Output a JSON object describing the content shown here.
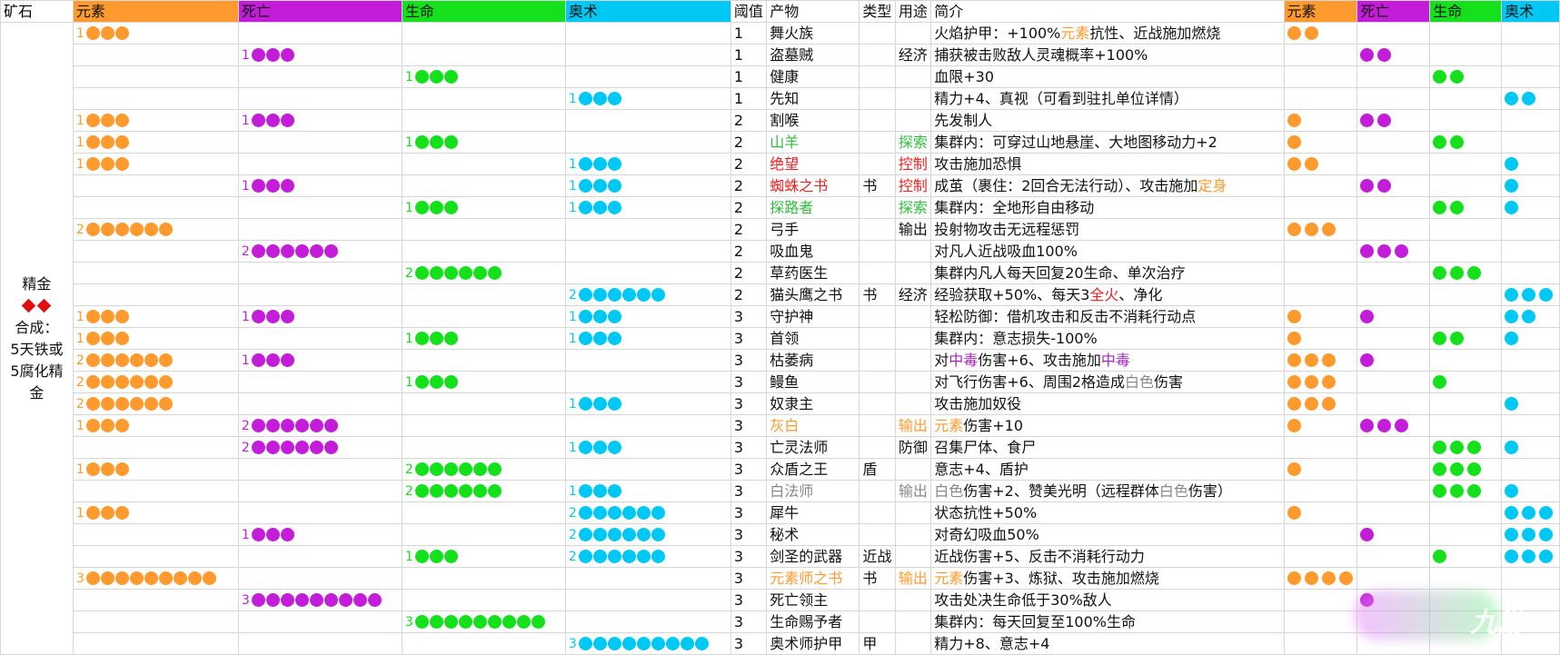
{
  "headers": {
    "ore": "矿石",
    "el": "元素",
    "de": "死亡",
    "li": "生命",
    "ar": "奥术",
    "thr": "阈值",
    "prod": "产物",
    "type": "类型",
    "use": "用途",
    "desc": "简介",
    "el2": "元素",
    "de2": "死亡",
    "li2": "生命",
    "ar2": "奥术"
  },
  "ore": {
    "name": "精金",
    "line1": "合成：",
    "line2": "5天铁或",
    "line3": "5腐化精",
    "line4": "金"
  },
  "colors": {
    "element": "#ff9a2e",
    "death": "#c41dd9",
    "life": "#14e01c",
    "arcane": "#00c8f5"
  },
  "watermark": "九游",
  "rows": [
    {
      "el": 1,
      "de": 0,
      "li": 0,
      "ar": 0,
      "thr": "1",
      "prod": "舞火族",
      "pc": "",
      "type": "",
      "use": "",
      "uc": "",
      "desc": [
        [
          "火焰护甲：+100%",
          ""
        ],
        [
          "元素",
          "t-orange"
        ],
        [
          "抗性、近战施加燃烧",
          ""
        ]
      ],
      "r": [
        2,
        0,
        0,
        0
      ]
    },
    {
      "el": 0,
      "de": 1,
      "li": 0,
      "ar": 0,
      "thr": "1",
      "prod": "盗墓贼",
      "pc": "",
      "type": "",
      "use": "经济",
      "uc": "",
      "desc": [
        [
          "捕获被击败敌人灵魂概率+100%",
          ""
        ]
      ],
      "r": [
        0,
        2,
        0,
        0
      ]
    },
    {
      "el": 0,
      "de": 0,
      "li": 1,
      "ar": 0,
      "thr": "1",
      "prod": "健康",
      "pc": "",
      "type": "",
      "use": "",
      "uc": "",
      "desc": [
        [
          "血限+30",
          ""
        ]
      ],
      "r": [
        0,
        0,
        2,
        0
      ]
    },
    {
      "el": 0,
      "de": 0,
      "li": 0,
      "ar": 1,
      "thr": "1",
      "prod": "先知",
      "pc": "",
      "type": "",
      "use": "",
      "uc": "",
      "desc": [
        [
          "精力+4、真视（可看到驻扎单位详情）",
          ""
        ]
      ],
      "r": [
        0,
        0,
        0,
        2
      ]
    },
    {
      "el": 1,
      "de": 1,
      "li": 0,
      "ar": 0,
      "thr": "2",
      "prod": "割喉",
      "pc": "",
      "type": "",
      "use": "",
      "uc": "",
      "desc": [
        [
          "先发制人",
          ""
        ]
      ],
      "r": [
        1,
        2,
        0,
        0
      ]
    },
    {
      "el": 1,
      "de": 0,
      "li": 1,
      "ar": 0,
      "thr": "2",
      "prod": "山羊",
      "pc": "t-green",
      "type": "",
      "use": "探索",
      "uc": "t-green",
      "desc": [
        [
          "集群内：可穿过山地悬崖、大地图移动力+2",
          ""
        ]
      ],
      "r": [
        1,
        0,
        2,
        0
      ]
    },
    {
      "el": 1,
      "de": 0,
      "li": 0,
      "ar": 1,
      "thr": "2",
      "prod": "绝望",
      "pc": "t-red",
      "type": "",
      "use": "控制",
      "uc": "t-red",
      "desc": [
        [
          "攻击施加恐惧",
          ""
        ]
      ],
      "r": [
        2,
        0,
        0,
        1
      ]
    },
    {
      "el": 0,
      "de": 1,
      "li": 0,
      "ar": 1,
      "thr": "2",
      "prod": "蜘蛛之书",
      "pc": "t-red",
      "type": "书",
      "use": "控制",
      "uc": "t-red",
      "desc": [
        [
          "成茧（裹住：2回合无法行动）、攻击施加",
          ""
        ],
        [
          "定身",
          "t-orange"
        ]
      ],
      "r": [
        0,
        2,
        0,
        1
      ]
    },
    {
      "el": 0,
      "de": 0,
      "li": 1,
      "ar": 1,
      "thr": "2",
      "prod": "探路者",
      "pc": "t-green",
      "type": "",
      "use": "探索",
      "uc": "t-green",
      "desc": [
        [
          "集群内：全地形自由移动",
          ""
        ]
      ],
      "r": [
        0,
        0,
        2,
        1
      ]
    },
    {
      "el": 2,
      "de": 0,
      "li": 0,
      "ar": 0,
      "thr": "2",
      "prod": "弓手",
      "pc": "",
      "type": "",
      "use": "输出",
      "uc": "",
      "desc": [
        [
          "投射物攻击无远程惩罚",
          ""
        ]
      ],
      "r": [
        3,
        0,
        0,
        0
      ]
    },
    {
      "el": 0,
      "de": 2,
      "li": 0,
      "ar": 0,
      "thr": "2",
      "prod": "吸血鬼",
      "pc": "",
      "type": "",
      "use": "",
      "uc": "",
      "desc": [
        [
          "对凡人近战吸血100%",
          ""
        ]
      ],
      "r": [
        0,
        3,
        0,
        0
      ]
    },
    {
      "el": 0,
      "de": 0,
      "li": 2,
      "ar": 0,
      "thr": "2",
      "prod": "草药医生",
      "pc": "",
      "type": "",
      "use": "",
      "uc": "",
      "desc": [
        [
          "集群内凡人每天回复20生命、单次治疗",
          ""
        ]
      ],
      "r": [
        0,
        0,
        3,
        0
      ]
    },
    {
      "el": 0,
      "de": 0,
      "li": 0,
      "ar": 2,
      "thr": "2",
      "prod": "猫头鹰之书",
      "pc": "",
      "type": "书",
      "use": "经济",
      "uc": "",
      "desc": [
        [
          "经验获取+50%、每天3",
          ""
        ],
        [
          "全火",
          "t-red"
        ],
        [
          "、净化",
          ""
        ]
      ],
      "r": [
        0,
        0,
        0,
        3
      ]
    },
    {
      "el": 1,
      "de": 1,
      "li": 0,
      "ar": 1,
      "thr": "3",
      "prod": "守护神",
      "pc": "",
      "type": "",
      "use": "",
      "uc": "",
      "desc": [
        [
          "轻松防御：借机攻击和反击不消耗行动点",
          ""
        ]
      ],
      "r": [
        1,
        1,
        0,
        2
      ]
    },
    {
      "el": 1,
      "de": 0,
      "li": 1,
      "ar": 1,
      "thr": "3",
      "prod": "首领",
      "pc": "",
      "type": "",
      "use": "",
      "uc": "",
      "desc": [
        [
          "集群内：意志损失-100%",
          ""
        ]
      ],
      "r": [
        1,
        0,
        2,
        1
      ]
    },
    {
      "el": 2,
      "de": 1,
      "li": 0,
      "ar": 0,
      "thr": "3",
      "prod": "枯萎病",
      "pc": "",
      "type": "",
      "use": "",
      "uc": "",
      "desc": [
        [
          "对",
          ""
        ],
        [
          "中毒",
          "t-purple"
        ],
        [
          "伤害+6、攻击施加",
          ""
        ],
        [
          "中毒",
          "t-purple"
        ]
      ],
      "r": [
        3,
        1,
        0,
        0
      ]
    },
    {
      "el": 2,
      "de": 0,
      "li": 1,
      "ar": 0,
      "thr": "3",
      "prod": "鳗鱼",
      "pc": "",
      "type": "",
      "use": "",
      "uc": "",
      "desc": [
        [
          "对飞行伤害+6、周围2格造成",
          ""
        ],
        [
          "白色",
          "t-gray"
        ],
        [
          "伤害",
          ""
        ]
      ],
      "r": [
        3,
        0,
        1,
        0
      ]
    },
    {
      "el": 2,
      "de": 0,
      "li": 0,
      "ar": 1,
      "thr": "3",
      "prod": "奴隶主",
      "pc": "",
      "type": "",
      "use": "",
      "uc": "",
      "desc": [
        [
          "攻击施加奴役",
          ""
        ]
      ],
      "r": [
        3,
        0,
        0,
        1
      ]
    },
    {
      "el": 1,
      "de": 2,
      "li": 0,
      "ar": 0,
      "thr": "3",
      "prod": "灰白",
      "pc": "t-orange",
      "type": "",
      "use": "输出",
      "uc": "t-orange",
      "desc": [
        [
          "元素",
          "t-orange"
        ],
        [
          "伤害+10",
          ""
        ]
      ],
      "r": [
        1,
        3,
        0,
        0
      ]
    },
    {
      "el": 0,
      "de": 2,
      "li": 0,
      "ar": 1,
      "thr": "3",
      "prod": "亡灵法师",
      "pc": "",
      "type": "",
      "use": "防御",
      "uc": "",
      "desc": [
        [
          "召集尸体、食尸",
          ""
        ]
      ],
      "r": [
        0,
        0,
        3,
        1
      ]
    },
    {
      "el": 1,
      "de": 0,
      "li": 2,
      "ar": 0,
      "thr": "3",
      "prod": "众盾之王",
      "pc": "",
      "type": "盾",
      "use": "",
      "uc": "",
      "desc": [
        [
          "意志+4、盾护",
          ""
        ]
      ],
      "r": [
        1,
        0,
        3,
        0
      ]
    },
    {
      "el": 0,
      "de": 0,
      "li": 2,
      "ar": 1,
      "thr": "3",
      "prod": "白法师",
      "pc": "t-gray",
      "type": "",
      "use": "输出",
      "uc": "t-gray",
      "desc": [
        [
          "白色",
          "t-gray"
        ],
        [
          "伤害+2、赞美光明（远程群体",
          ""
        ],
        [
          "白色",
          "t-gray"
        ],
        [
          "伤害）",
          ""
        ]
      ],
      "r": [
        0,
        0,
        3,
        1
      ]
    },
    {
      "el": 1,
      "de": 0,
      "li": 0,
      "ar": 2,
      "thr": "3",
      "prod": "犀牛",
      "pc": "",
      "type": "",
      "use": "",
      "uc": "",
      "desc": [
        [
          "状态抗性+50%",
          ""
        ]
      ],
      "r": [
        1,
        0,
        0,
        3
      ]
    },
    {
      "el": 0,
      "de": 1,
      "li": 0,
      "ar": 2,
      "thr": "3",
      "prod": "秘术",
      "pc": "",
      "type": "",
      "use": "",
      "uc": "",
      "desc": [
        [
          "对奇幻吸血50%",
          ""
        ]
      ],
      "r": [
        0,
        1,
        0,
        3
      ]
    },
    {
      "el": 0,
      "de": 0,
      "li": 1,
      "ar": 2,
      "thr": "3",
      "prod": "剑圣的武器",
      "pc": "",
      "type": "近战",
      "use": "",
      "uc": "",
      "desc": [
        [
          "近战伤害+5、反击不消耗行动力",
          ""
        ]
      ],
      "r": [
        0,
        0,
        1,
        3
      ]
    },
    {
      "el": 3,
      "de": 0,
      "li": 0,
      "ar": 0,
      "thr": "3",
      "prod": "元素师之书",
      "pc": "t-orange",
      "type": "书",
      "use": "输出",
      "uc": "t-orange",
      "desc": [
        [
          "元素",
          "t-orange"
        ],
        [
          "伤害+3、炼狱、攻击施加燃烧",
          ""
        ]
      ],
      "r": [
        4,
        0,
        0,
        0
      ]
    },
    {
      "el": 0,
      "de": 3,
      "li": 0,
      "ar": 0,
      "thr": "3",
      "prod": "死亡领主",
      "pc": "",
      "type": "",
      "use": "",
      "uc": "",
      "desc": [
        [
          "攻击处决生命低于30%敌人",
          ""
        ]
      ],
      "r": [
        0,
        1,
        0,
        0
      ]
    },
    {
      "el": 0,
      "de": 0,
      "li": 3,
      "ar": 0,
      "thr": "3",
      "prod": "生命赐予者",
      "pc": "",
      "type": "",
      "use": "",
      "uc": "",
      "desc": [
        [
          "集群内：每天回复至100%生命",
          ""
        ]
      ],
      "r": [
        0,
        0,
        0,
        0
      ]
    },
    {
      "el": 0,
      "de": 0,
      "li": 0,
      "ar": 3,
      "thr": "3",
      "prod": "奥术师护甲",
      "pc": "",
      "type": "甲",
      "use": "",
      "uc": "",
      "desc": [
        [
          "精力+8、意志+4",
          ""
        ]
      ],
      "r": [
        0,
        0,
        0,
        0
      ]
    }
  ]
}
